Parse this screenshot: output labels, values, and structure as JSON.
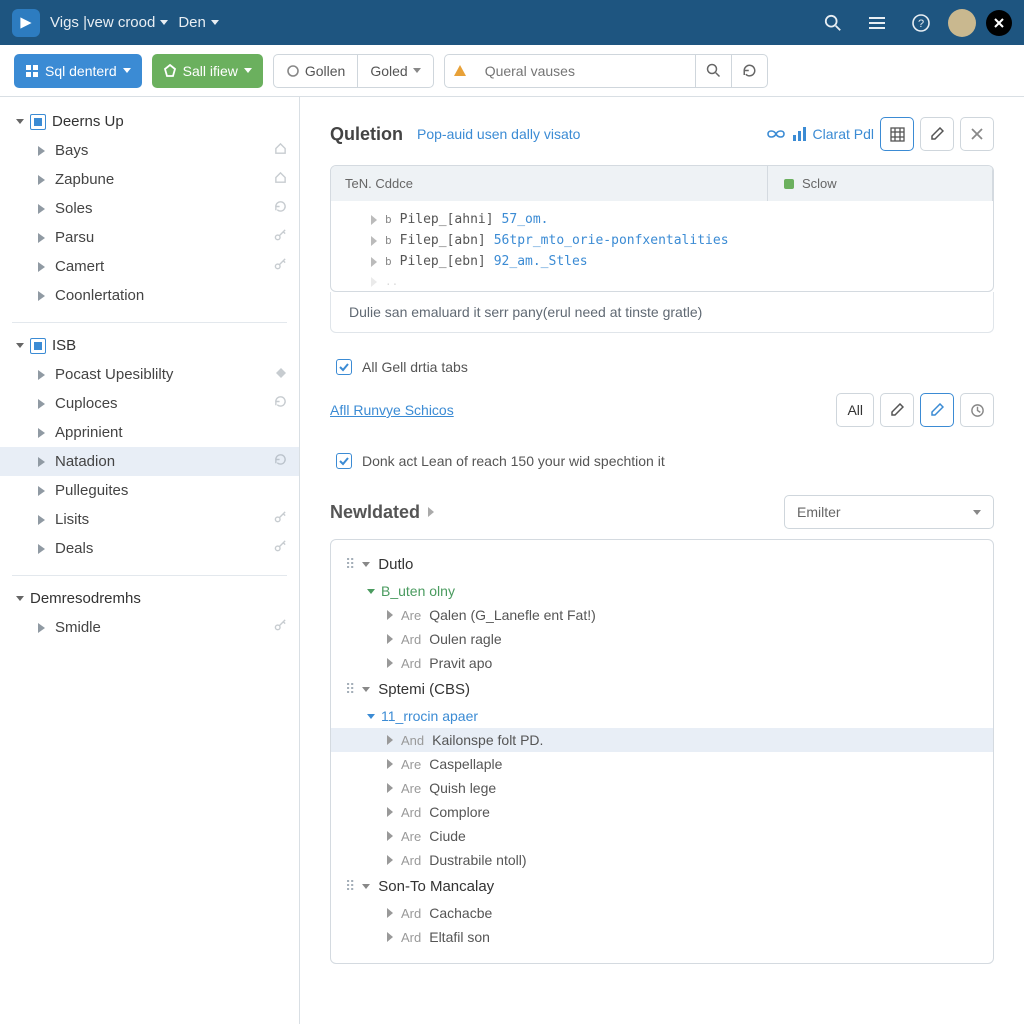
{
  "topbar": {
    "project_dropdown": "Vigs |vew crood",
    "second_dropdown": "Den"
  },
  "toolbar": {
    "sql_btn": "Sql denterd",
    "run_btn": "Sall ifiew",
    "group_a": "Gollen",
    "group_b": "Goled",
    "search_placeholder": "Queral vauses"
  },
  "sidebar": {
    "section1_title": "Deerns Up",
    "section1_items": [
      {
        "label": "Bays",
        "icon": "home"
      },
      {
        "label": "Zapbune",
        "icon": "home"
      },
      {
        "label": "Soles",
        "icon": "refresh"
      },
      {
        "label": "Parsu",
        "icon": "key"
      },
      {
        "label": "Camert",
        "icon": "key"
      },
      {
        "label": "Coonlertation",
        "icon": ""
      }
    ],
    "section2_title": "ISB",
    "section2_items": [
      {
        "label": "Pocast Upesiblilty",
        "icon": "diamond"
      },
      {
        "label": "Cuploces",
        "icon": "refresh"
      },
      {
        "label": "Apprinient",
        "icon": ""
      },
      {
        "label": "Natadion",
        "icon": "refresh",
        "selected": true
      },
      {
        "label": "Pulleguites",
        "icon": ""
      },
      {
        "label": "Lisits",
        "icon": "key"
      },
      {
        "label": "Deals",
        "icon": "key"
      }
    ],
    "section3_title": "Demresodremhs",
    "section3_items": [
      {
        "label": "Smidle",
        "icon": "key"
      }
    ]
  },
  "main": {
    "title": "Quletion",
    "subtitle": "Pop-auid usen dally visato",
    "chart_label": "Clarat Pdl",
    "code_tab_left": "TeN. Cddce",
    "code_tab_right": "Sclow",
    "code_lines": [
      {
        "tag": "b",
        "name": "Pilep_[ahni]",
        "value": "57_om."
      },
      {
        "tag": "b",
        "name": "Filep_[abn]",
        "value": "56tpr_mto_orie-ponfxentalities"
      },
      {
        "tag": "b",
        "name": "Pilep_[ebn]",
        "value": "92_am._Stles"
      }
    ],
    "info_text": "Dulie san emaluard it serr pany(erul need at tinste gratle)",
    "check1": "All Gell drtia tabs",
    "link_actions": "Afll Runvye Schicos",
    "btn_all": "All",
    "check2": "Donk act Lean of reach 150 your wid spechtion it",
    "newdated_title": "Newldated",
    "emitter_select": "Emilter",
    "results": [
      {
        "title": "Dutlo",
        "sub": "B_uten olny",
        "sub_color": "green",
        "items": [
          {
            "type": "Are",
            "name": "Qalen (G_Lanefle ent Fat!)"
          },
          {
            "type": "Ard",
            "name": "Oulen ragle"
          },
          {
            "type": "Ard",
            "name": "Pravit apo"
          }
        ]
      },
      {
        "title": "Sptemi (CBS)",
        "sub": "11_rrocin apaer",
        "sub_color": "blue",
        "items": [
          {
            "type": "And",
            "name": "Kailonspe folt PD.",
            "highlight": true
          },
          {
            "type": "Are",
            "name": "Caspellaple"
          },
          {
            "type": "Are",
            "name": "Quish lege"
          },
          {
            "type": "Ard",
            "name": "Complore"
          },
          {
            "type": "Are",
            "name": "Ciude"
          },
          {
            "type": "Ard",
            "name": "Dustrabile ntoll)"
          }
        ]
      },
      {
        "title": "Son-To Mancalay",
        "sub": null,
        "items": [
          {
            "type": "Ard",
            "name": "Cachacbe"
          },
          {
            "type": "Ard",
            "name": "Eltafil son"
          }
        ]
      }
    ]
  }
}
